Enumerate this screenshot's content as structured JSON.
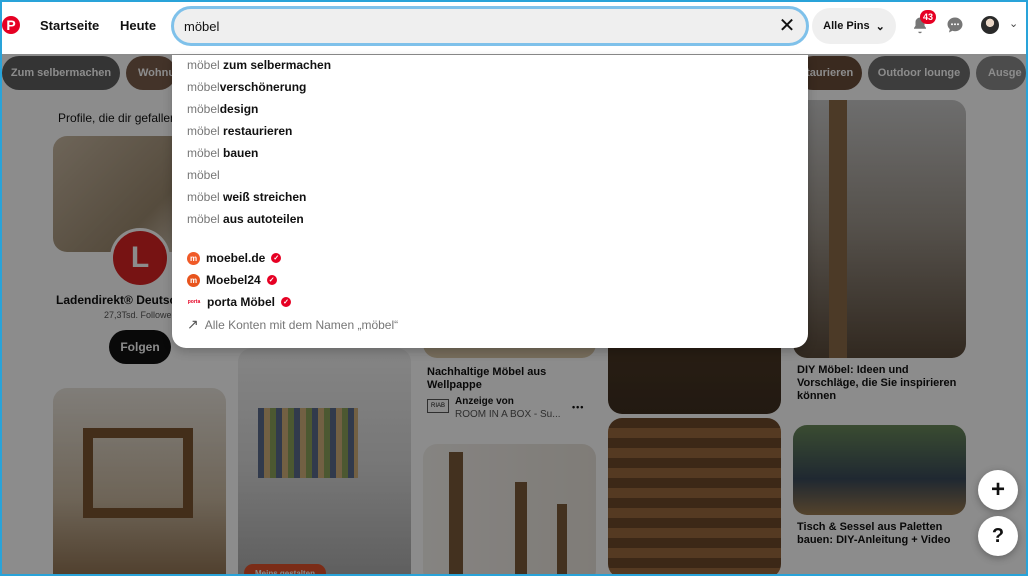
{
  "header": {
    "logo_letter": "P",
    "nav_home": "Startseite",
    "nav_today": "Heute",
    "search_value": "möbel",
    "filter_label": "Alle Pins",
    "notifications_count": "43"
  },
  "chips": [
    {
      "label": "Zum selbermachen",
      "color": "#5f5f5f"
    },
    {
      "label": "Wohnu",
      "color": "#7a5d4c"
    },
    {
      "label": "staurieren",
      "color": "#6b4d3a"
    },
    {
      "label": "Outdoor lounge",
      "color": "#6f6f6f"
    },
    {
      "label": "Ausge",
      "color": "#8a8a8a"
    }
  ],
  "dropdown": {
    "suggestions": [
      {
        "prefix": "möbel",
        "rest": " zum selbermachen"
      },
      {
        "prefix": "möbel",
        "rest": "verschönerung"
      },
      {
        "prefix": "möbel",
        "rest": "design"
      },
      {
        "prefix": "möbel",
        "rest": " restaurieren"
      },
      {
        "prefix": "möbel",
        "rest": " bauen"
      },
      {
        "prefix": "möbel",
        "rest": ""
      },
      {
        "prefix": "möbel",
        "rest": " weiß streichen"
      },
      {
        "prefix": "möbel",
        "rest": " aus autoteilen"
      }
    ],
    "accounts": [
      {
        "name": "moebel.de",
        "logo": "m",
        "color": "#f05a28"
      },
      {
        "name": "Moebel24",
        "logo": "m",
        "color": "#e8541d"
      },
      {
        "name": "porta Möbel",
        "logo": "porta",
        "color": "#e60023"
      }
    ],
    "all_accounts": "Alle Konten mit dem Namen „möbel“"
  },
  "profile": {
    "heading": "Profile, die dir gefallen",
    "name": "Ladendirekt® Deutsch",
    "followers": "27,3Tsd. Followe",
    "follow_button": "Folgen",
    "logo_letter": "L"
  },
  "pins": {
    "pin1_title": "Nachhaltige Möbel aus Wellpappe",
    "pin1_ad_label": "Anzeige von",
    "pin1_ad_source": "ROOM IN A BOX - Su...",
    "pin1_more": "•••",
    "pin2_title": "DIY Möbel: Ideen und Vorschläge, die Sie inspirieren können",
    "pin3_title": "Tisch & Sessel aus Paletten bauen: DIY-Anleitung + Video",
    "shop_button": "Meins gestalten"
  },
  "fab": {
    "plus": "+",
    "help": "?"
  }
}
